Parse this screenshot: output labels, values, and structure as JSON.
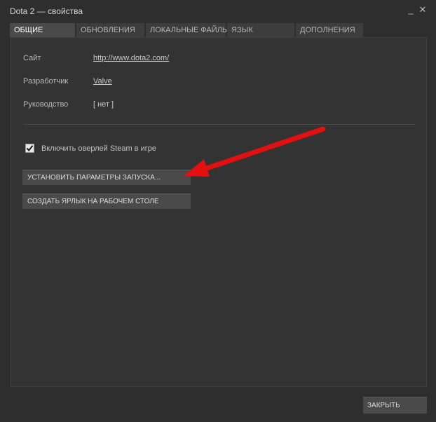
{
  "window": {
    "title": "Dota 2 — свойства",
    "minimize_glyph": "_",
    "close_glyph": "✕"
  },
  "tabs": [
    {
      "label": "ОБЩИЕ",
      "active": true
    },
    {
      "label": "ОБНОВЛЕНИЯ",
      "active": false
    },
    {
      "label": "ЛОКАЛЬНЫЕ ФАЙЛЫ",
      "active": false
    },
    {
      "label": "ЯЗЫК",
      "active": false
    },
    {
      "label": "ДОПОЛНЕНИЯ",
      "active": false
    }
  ],
  "info": {
    "site_label": "Сайт",
    "site_value": "http://www.dota2.com/",
    "developer_label": "Разработчик",
    "developer_value": "Valve",
    "manual_label": "Руководство",
    "manual_value": "[ нет ]"
  },
  "overlay": {
    "label": "Включить оверлей Steam в игре",
    "checked": true
  },
  "buttons": {
    "launch_options": "УСТАНОВИТЬ ПАРАМЕТРЫ ЗАПУСКА...",
    "desktop_shortcut": "СОЗДАТЬ ЯРЛЫК НА РАБОЧЕМ СТОЛЕ",
    "close": "ЗАКРЫТЬ"
  },
  "colors": {
    "annotation_arrow": "#e21010",
    "active_tab": "#4a4a4a",
    "inactive_tab": "#3d3d3d",
    "panel_bg": "#333333"
  }
}
